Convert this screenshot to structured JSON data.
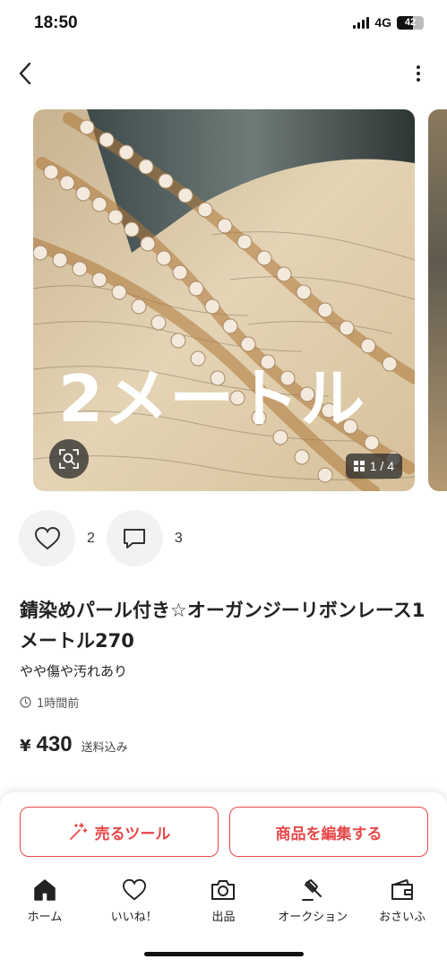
{
  "status_bar": {
    "time": "18:50",
    "network": "4G",
    "battery": "42"
  },
  "gallery": {
    "overlay_text": "2メートル",
    "counter": "1 / 4",
    "icons": {
      "zoom": "image-search-icon",
      "grid": "grid-icon"
    }
  },
  "actions": {
    "likes_count": "2",
    "comments_count": "3",
    "icons": {
      "like": "heart-icon",
      "comment": "comment-icon"
    }
  },
  "item": {
    "title": "錆染めパール付き☆オーガンジーリボンレース1メートル270",
    "condition": "やや傷や汚れあり",
    "posted": "1時間前",
    "price_symbol": "¥",
    "price": "430",
    "shipping": "送料込み"
  },
  "buttons": {
    "sell_tool": "売るツール",
    "edit_item": "商品を編集する"
  },
  "tabbar": [
    {
      "label": "ホーム",
      "icon": "home-icon"
    },
    {
      "label": "いいね！",
      "icon": "heart-icon"
    },
    {
      "label": "出品",
      "icon": "camera-icon"
    },
    {
      "label": "オークション",
      "icon": "gavel-icon"
    },
    {
      "label": "おさいふ",
      "icon": "wallet-icon"
    }
  ],
  "colors": {
    "accent": "#e8484a"
  }
}
